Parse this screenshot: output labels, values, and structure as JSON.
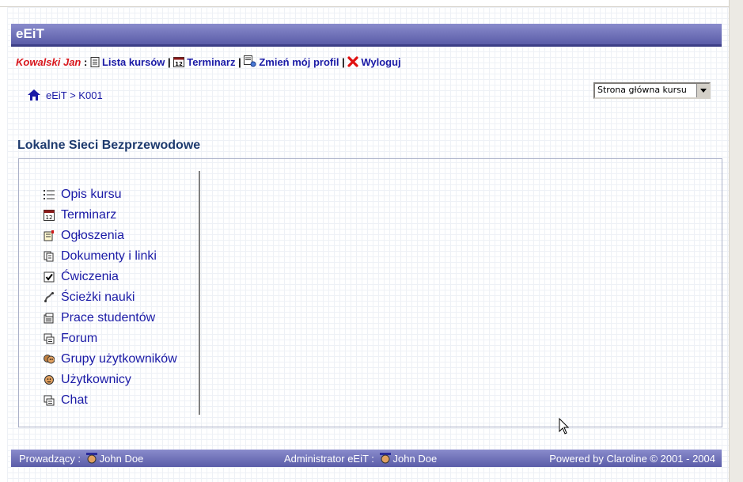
{
  "app": {
    "title": "eEiT"
  },
  "userbar": {
    "user": "Kowalski Jan",
    "links": [
      {
        "label": "Lista kursów",
        "icon": "document-icon"
      },
      {
        "label": "Terminarz",
        "icon": "calendar-icon"
      },
      {
        "label": "Zmień mój profil",
        "icon": "profile-icon"
      },
      {
        "label": "Wyloguj",
        "icon": "logout-x-icon"
      }
    ]
  },
  "breadcrumb": {
    "text": "eEiT > K001"
  },
  "course_select": {
    "value": "Strona główna kursu"
  },
  "course": {
    "title": "Lokalne Sieci Bezprzewodowe"
  },
  "menu": [
    {
      "label": "Opis kursu",
      "icon": "list-icon"
    },
    {
      "label": "Terminarz",
      "icon": "calendar-icon"
    },
    {
      "label": "Ogłoszenia",
      "icon": "announcement-icon"
    },
    {
      "label": "Dokumenty i linki",
      "icon": "documents-icon"
    },
    {
      "label": "Ćwiczenia",
      "icon": "checkbox-icon"
    },
    {
      "label": "Ścieżki nauki",
      "icon": "path-icon"
    },
    {
      "label": "Prace studentów",
      "icon": "assignments-icon"
    },
    {
      "label": "Forum",
      "icon": "forum-icon"
    },
    {
      "label": "Grupy użytkowników",
      "icon": "groups-icon"
    },
    {
      "label": "Użytkownicy",
      "icon": "user-icon"
    },
    {
      "label": "Chat",
      "icon": "chat-icon"
    }
  ],
  "footer": {
    "left_label": "Prowadzący :",
    "left_name": "John Doe",
    "middle_label": "Administrator eEiT :",
    "middle_name": "John Doe",
    "right": "Powered by Claroline © 2001 - 2004"
  },
  "colors": {
    "banner": "#6a6cb8",
    "link": "#1a1aa6",
    "user": "#d8161c"
  }
}
